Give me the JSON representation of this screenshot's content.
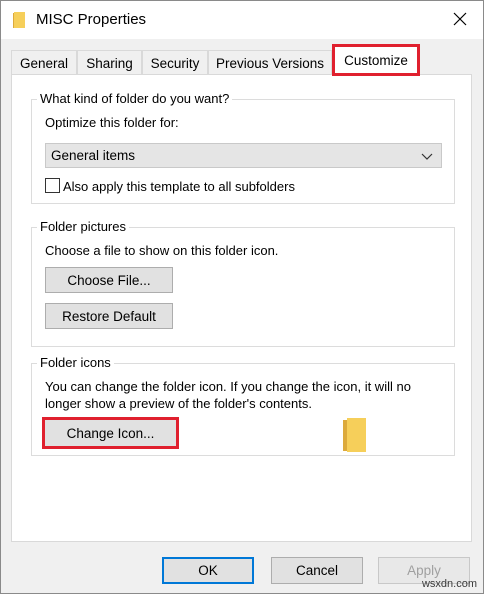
{
  "window": {
    "title": "MISC Properties"
  },
  "tabs": [
    {
      "label": "General"
    },
    {
      "label": "Sharing"
    },
    {
      "label": "Security"
    },
    {
      "label": "Previous Versions"
    },
    {
      "label": "Customize",
      "active": true
    }
  ],
  "folder_type": {
    "group_label": "What kind of folder do you want?",
    "optimize_label": "Optimize this folder for:",
    "selected_option": "General items",
    "checkbox_label": "Also apply this template to all subfolders",
    "checkbox_checked": false
  },
  "folder_pictures": {
    "group_label": "Folder pictures",
    "description": "Choose a file to show on this folder icon.",
    "choose_file_label": "Choose File...",
    "restore_default_label": "Restore Default"
  },
  "folder_icons": {
    "group_label": "Folder icons",
    "description_line1": "You can change the folder icon. If you change the icon, it will no",
    "description_line2": "longer show a preview of the folder's contents.",
    "change_icon_label": "Change Icon..."
  },
  "footer": {
    "ok_label": "OK",
    "cancel_label": "Cancel",
    "apply_label": "Apply"
  },
  "watermark": "wsxdn.com",
  "colors": {
    "highlight": "#e0202e",
    "folder_yellow": "#f2c94c",
    "accent": "#0078d7"
  },
  "icons": {
    "title": "folder-icon",
    "close": "close-icon",
    "dropdown": "chevron-down-icon",
    "preview": "folder-icon"
  }
}
